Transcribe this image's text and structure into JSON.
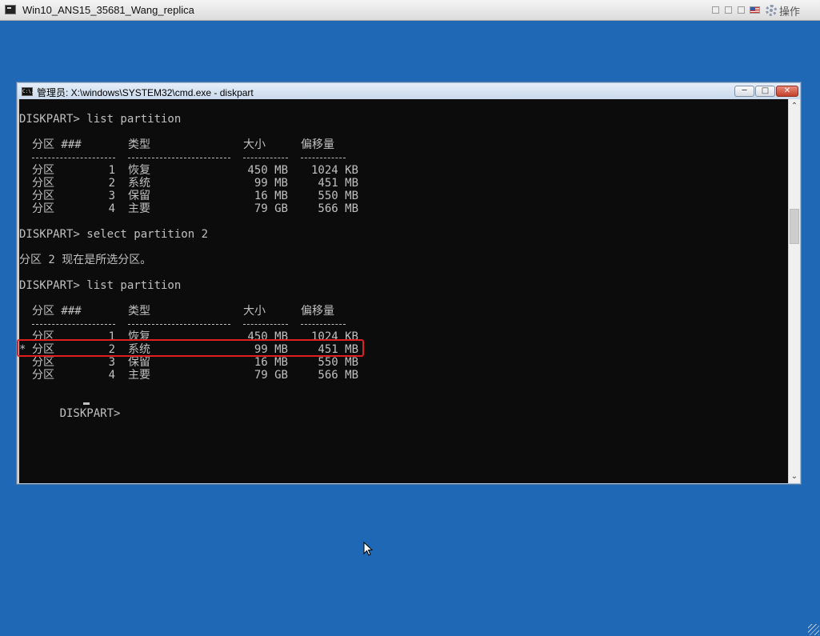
{
  "host": {
    "title": "Win10_ANS15_35681_Wang_replica",
    "action_label": "操作",
    "icons": [
      "window-icon",
      "restore-icon",
      "minimize-icon",
      "full-icon",
      "flag-icon",
      "gear-icon"
    ]
  },
  "cmd": {
    "title": "管理员: X:\\windows\\SYSTEM32\\cmd.exe - diskpart",
    "icon_text": "C:\\.",
    "minimize_symbol": "─",
    "maximize_symbol": "□",
    "close_symbol": "✕",
    "scroll_up": "⌃",
    "scroll_down": "⌄"
  },
  "console": {
    "cmd1": "DISKPART> list partition",
    "header1": {
      "col1": "分区 ###",
      "col2": "类型",
      "col3": "大小",
      "col4": "偏移量"
    },
    "rows1": [
      {
        "label": "分区",
        "num": "1",
        "type": "恢复",
        "size": "450 MB",
        "offset": "1024 KB"
      },
      {
        "label": "分区",
        "num": "2",
        "type": "系统",
        "size": "99 MB",
        "offset": "451 MB"
      },
      {
        "label": "分区",
        "num": "3",
        "type": "保留",
        "size": "16 MB",
        "offset": "550 MB"
      },
      {
        "label": "分区",
        "num": "4",
        "type": "主要",
        "size": "79 GB",
        "offset": "566 MB"
      }
    ],
    "cmd2": "DISKPART> select partition 2",
    "message": "分区 2 现在是所选分区。",
    "cmd3": "DISKPART> list partition",
    "header2": {
      "col1": "分区 ###",
      "col2": "类型",
      "col3": "大小",
      "col4": "偏移量"
    },
    "rows2": [
      {
        "marker": "",
        "label": "分区",
        "num": "1",
        "type": "恢复",
        "size": "450 MB",
        "offset": "1024 KB"
      },
      {
        "marker": "*",
        "label": "分区",
        "num": "2",
        "type": "系统",
        "size": "99 MB",
        "offset": "451 MB"
      },
      {
        "marker": "",
        "label": "分区",
        "num": "3",
        "type": "保留",
        "size": "16 MB",
        "offset": "550 MB"
      },
      {
        "marker": "",
        "label": "分区",
        "num": "4",
        "type": "主要",
        "size": "79 GB",
        "offset": "566 MB"
      }
    ],
    "prompt": "DISKPART> "
  },
  "colors": {
    "desktop": "#1e68b5",
    "console_bg": "#0c0c0c",
    "console_text": "#c0c0c0",
    "highlight": "#e02020"
  }
}
